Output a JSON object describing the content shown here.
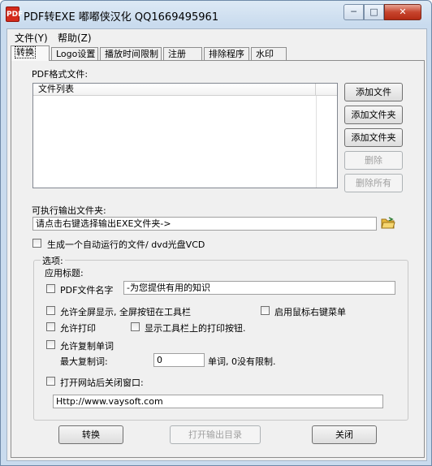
{
  "window": {
    "title": "PDF转EXE   嘟嘟侠汉化 QQ1669495961",
    "icon_label": "PDF",
    "controls": {
      "minimize": "─",
      "maximize": "□",
      "close": "✕"
    }
  },
  "menu": {
    "file": "文件(Y)",
    "help": "帮助(Z)"
  },
  "tabs": [
    {
      "label": "转换",
      "active": true
    },
    {
      "label": "Logo设置",
      "active": false
    },
    {
      "label": "播放时间限制",
      "active": false
    },
    {
      "label": "注册",
      "active": false
    },
    {
      "label": "排除程序",
      "active": false
    },
    {
      "label": "水印",
      "active": false
    }
  ],
  "pdf_section": {
    "label": "PDF格式文件:",
    "list_header": "文件列表",
    "buttons": {
      "add_file": "添加文件",
      "add_folder": "添加文件夹",
      "add_folder2": "添加文件夹",
      "remove": "删除",
      "remove_all": "删除所有"
    }
  },
  "output": {
    "label": "可执行输出文件夹:",
    "value": "请点击右键选择输出EXE文件夹->",
    "autorun_label": "生成一个自动运行的文件/ dvd光盘VCD"
  },
  "options": {
    "group_title": "选项:",
    "app_title_label": "应用标题:",
    "pdf_name_label": "PDF文件名字",
    "app_title_value": "-为您提供有用的知识",
    "fullscreen_label": "允许全屏显示, 全屏按钮在工具栏",
    "right_click_label": "启用鼠标右键菜单",
    "print_label": "允许打印",
    "toolbar_print_label": "显示工具栏上的打印按钮.",
    "copy_label": "允许复制单词",
    "max_copy_label": "最大复制词:",
    "max_copy_value": "0",
    "max_copy_suffix": "单词, 0没有限制.",
    "close_after_label": "打开网站后关闭窗口:",
    "url_value": "Http://www.vaysoft.com"
  },
  "bottom_buttons": {
    "convert": "转换",
    "open_output": "打开输出目录",
    "close": "关闭"
  }
}
